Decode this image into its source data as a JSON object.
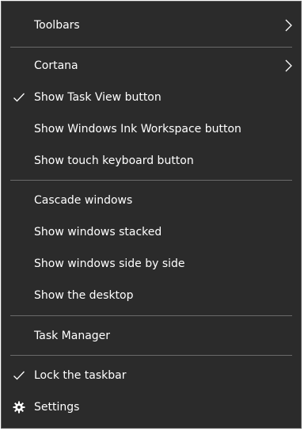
{
  "menu": {
    "toolbars": "Toolbars",
    "cortana": "Cortana",
    "show_task_view": "Show Task View button",
    "show_ink_workspace": "Show Windows Ink Workspace button",
    "show_touch_keyboard": "Show touch keyboard button",
    "cascade_windows": "Cascade windows",
    "show_stacked": "Show windows stacked",
    "show_side_by_side": "Show windows side by side",
    "show_desktop": "Show the desktop",
    "task_manager": "Task Manager",
    "lock_taskbar": "Lock the taskbar",
    "settings": "Settings"
  },
  "checked": {
    "show_task_view": true,
    "lock_taskbar": true
  },
  "icons": {
    "submenu": "chevron-right-icon",
    "checked": "checkmark-icon",
    "settings": "gear-icon"
  },
  "colors": {
    "background": "#2b2b2b",
    "text": "#ffffff",
    "separator": "#6a6a6a",
    "border": "#5a5a5a"
  }
}
